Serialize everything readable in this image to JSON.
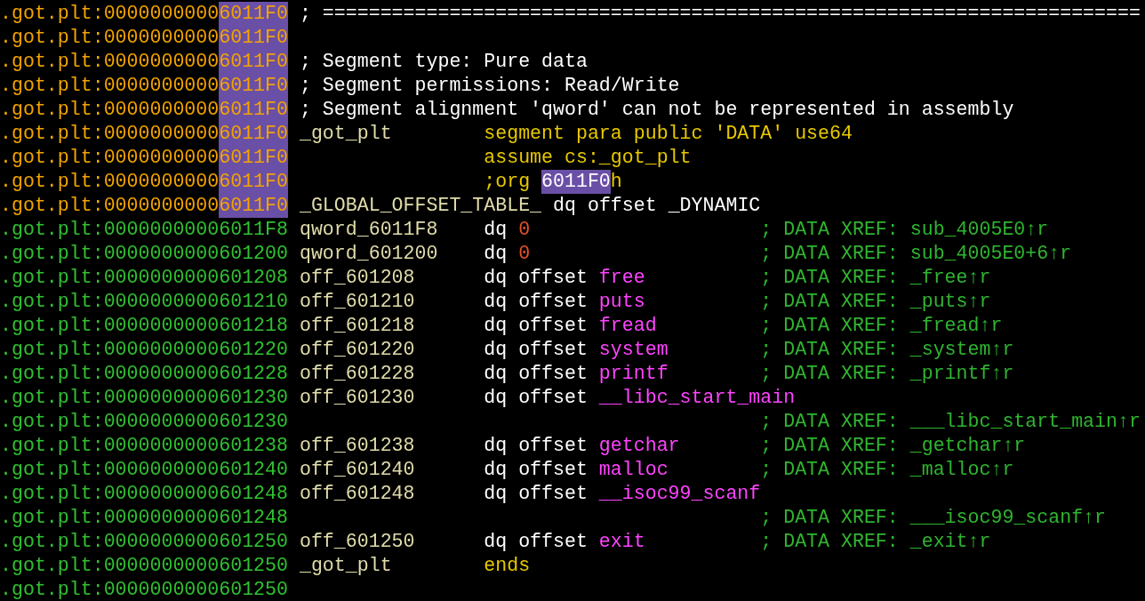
{
  "listing": [
    {
      "kind": "header",
      "address": ".got.plt:0000000000",
      "match": "6011F0",
      "comment": "; ======================================================================="
    },
    {
      "kind": "header",
      "address": ".got.plt:0000000000",
      "match": "6011F0"
    },
    {
      "kind": "header",
      "address": ".got.plt:0000000000",
      "match": "6011F0",
      "comment": "; Segment type: Pure data"
    },
    {
      "kind": "header",
      "address": ".got.plt:0000000000",
      "match": "6011F0",
      "comment": "; Segment permissions: Read/Write"
    },
    {
      "kind": "header",
      "address": ".got.plt:0000000000",
      "match": "6011F0",
      "comment": "; Segment alignment 'qword' can not be represented in assembly"
    },
    {
      "kind": "header",
      "address": ".got.plt:0000000000",
      "match": "6011F0",
      "label": "_got_plt",
      "tokens": [
        {
          "kind": "directive",
          "text": "segment para public 'DATA' use64"
        }
      ]
    },
    {
      "kind": "header",
      "address": ".got.plt:0000000000",
      "match": "6011F0",
      "tokens": [
        {
          "kind": "directive",
          "text": "assume cs:_got_plt"
        }
      ]
    },
    {
      "kind": "header",
      "address": ".got.plt:0000000000",
      "match": "6011F0",
      "tokens": [
        {
          "kind": "directive",
          "text": ";org "
        },
        {
          "kind": "match",
          "text": "6011F0"
        },
        {
          "kind": "directive",
          "text": "h"
        }
      ]
    },
    {
      "kind": "header",
      "address": ".got.plt:0000000000",
      "match": "6011F0",
      "label": "_GLOBAL_OFFSET_TABLE_",
      "tokens": [
        {
          "kind": "keyword",
          "text": "dq offset _DYNAMIC"
        }
      ]
    },
    {
      "kind": "data",
      "address": ".got.plt:00000000006011F8",
      "label": "qword_6011F8",
      "tokens": [
        {
          "kind": "keyword",
          "text": "dq "
        },
        {
          "kind": "number",
          "text": "0"
        }
      ],
      "comment": "; DATA XREF: sub_4005E0↑r"
    },
    {
      "kind": "data",
      "address": ".got.plt:0000000000601200",
      "label": "qword_601200",
      "tokens": [
        {
          "kind": "keyword",
          "text": "dq "
        },
        {
          "kind": "number",
          "text": "0"
        }
      ],
      "comment": "; DATA XREF: sub_4005E0+6↑r"
    },
    {
      "kind": "data",
      "address": ".got.plt:0000000000601208",
      "label": "off_601208",
      "tokens": [
        {
          "kind": "keyword",
          "text": "dq offset "
        },
        {
          "kind": "import",
          "text": "free"
        }
      ],
      "comment": "; DATA XREF: _free↑r"
    },
    {
      "kind": "data",
      "address": ".got.plt:0000000000601210",
      "label": "off_601210",
      "tokens": [
        {
          "kind": "keyword",
          "text": "dq offset "
        },
        {
          "kind": "import",
          "text": "puts"
        }
      ],
      "comment": "; DATA XREF: _puts↑r"
    },
    {
      "kind": "data",
      "address": ".got.plt:0000000000601218",
      "label": "off_601218",
      "tokens": [
        {
          "kind": "keyword",
          "text": "dq offset "
        },
        {
          "kind": "import",
          "text": "fread"
        }
      ],
      "comment": "; DATA XREF: _fread↑r"
    },
    {
      "kind": "data",
      "address": ".got.plt:0000000000601220",
      "label": "off_601220",
      "tokens": [
        {
          "kind": "keyword",
          "text": "dq offset "
        },
        {
          "kind": "import",
          "text": "system"
        }
      ],
      "comment": "; DATA XREF: _system↑r"
    },
    {
      "kind": "data",
      "address": ".got.plt:0000000000601228",
      "label": "off_601228",
      "tokens": [
        {
          "kind": "keyword",
          "text": "dq offset "
        },
        {
          "kind": "import",
          "text": "printf"
        }
      ],
      "comment": "; DATA XREF: _printf↑r"
    },
    {
      "kind": "data",
      "address": ".got.plt:0000000000601230",
      "label": "off_601230",
      "tokens": [
        {
          "kind": "keyword",
          "text": "dq offset "
        },
        {
          "kind": "import",
          "text": "__libc_start_main"
        }
      ]
    },
    {
      "kind": "data",
      "address": ".got.plt:0000000000601230",
      "comment": "; DATA XREF: ___libc_start_main↑r"
    },
    {
      "kind": "data",
      "address": ".got.plt:0000000000601238",
      "label": "off_601238",
      "tokens": [
        {
          "kind": "keyword",
          "text": "dq offset "
        },
        {
          "kind": "import",
          "text": "getchar"
        }
      ],
      "comment": "; DATA XREF: _getchar↑r"
    },
    {
      "kind": "data",
      "address": ".got.plt:0000000000601240",
      "label": "off_601240",
      "tokens": [
        {
          "kind": "keyword",
          "text": "dq offset "
        },
        {
          "kind": "import",
          "text": "malloc"
        }
      ],
      "comment": "; DATA XREF: _malloc↑r"
    },
    {
      "kind": "data",
      "address": ".got.plt:0000000000601248",
      "label": "off_601248",
      "tokens": [
        {
          "kind": "keyword",
          "text": "dq offset "
        },
        {
          "kind": "import",
          "text": "__isoc99_scanf"
        }
      ]
    },
    {
      "kind": "data",
      "address": ".got.plt:0000000000601248",
      "comment": "; DATA XREF: ___isoc99_scanf↑r"
    },
    {
      "kind": "data",
      "address": ".got.plt:0000000000601250",
      "label": "off_601250",
      "tokens": [
        {
          "kind": "keyword",
          "text": "dq offset "
        },
        {
          "kind": "import",
          "text": "exit"
        }
      ],
      "comment": "; DATA XREF: _exit↑r"
    },
    {
      "kind": "data",
      "address": ".got.plt:0000000000601250",
      "label": "_got_plt",
      "tokens": [
        {
          "kind": "directive",
          "text": "ends"
        }
      ]
    },
    {
      "kind": "data",
      "address": ".got.plt:0000000000601250"
    }
  ]
}
